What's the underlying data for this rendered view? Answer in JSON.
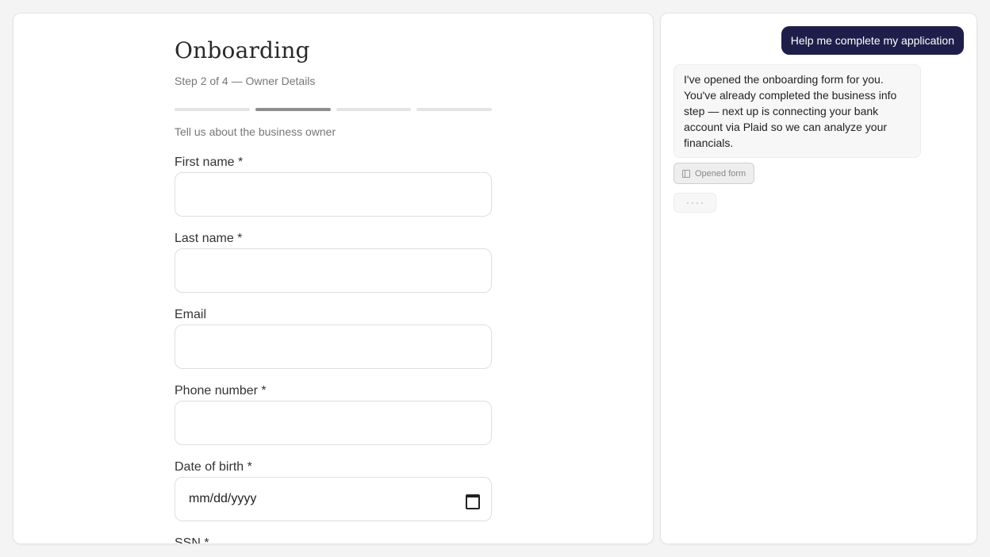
{
  "form": {
    "title": "Onboarding",
    "step_text": "Step 2 of 4 — Owner Details",
    "progress": {
      "total_steps": 4,
      "current_step": 2
    },
    "subtitle": "Tell us about the business owner",
    "fields": {
      "first_name": {
        "label": "First name *",
        "value": ""
      },
      "last_name": {
        "label": "Last name *",
        "value": ""
      },
      "email": {
        "label": "Email",
        "value": ""
      },
      "phone": {
        "label": "Phone number *",
        "value": ""
      },
      "dob": {
        "label": "Date of birth *",
        "placeholder": "mm/dd/yyyy"
      },
      "ssn": {
        "label": "SSN *"
      }
    }
  },
  "chat": {
    "user_message": "Help me complete my application",
    "assistant_message": "I've opened the onboarding form for you. You've already completed the business info step — next up is connecting your bank account via Plaid so we can analyze your financials.",
    "tool_chip": {
      "label": "Opened form",
      "icon": "panel-icon"
    },
    "typing_indicator": true
  },
  "colors": {
    "user_bubble": "#1f1e4b",
    "progress_active": "#8d8d8d",
    "progress_inactive": "#e4e4e4",
    "background": "#f4f4f4"
  }
}
